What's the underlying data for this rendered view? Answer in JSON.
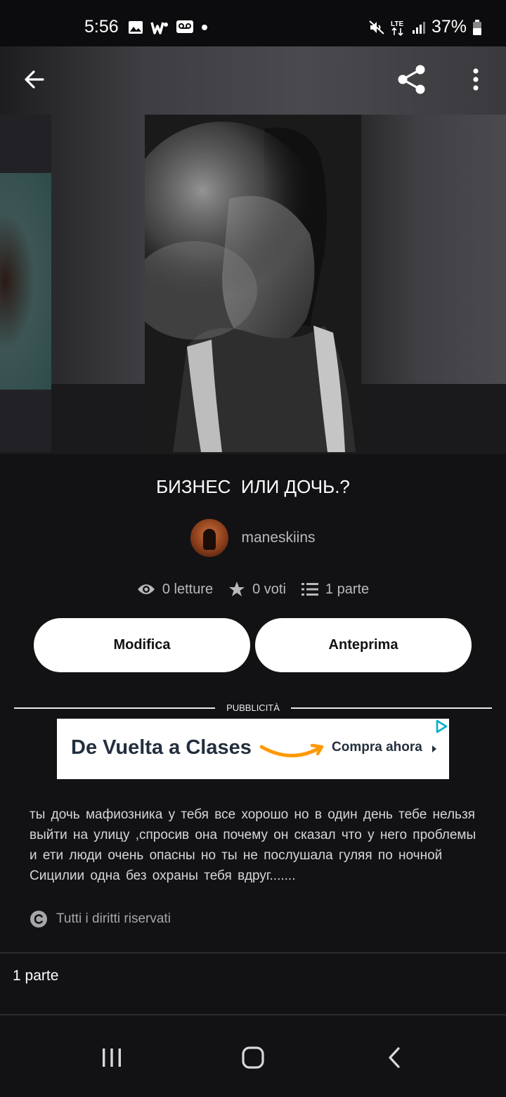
{
  "status_bar": {
    "time": "5:56",
    "battery": "37%",
    "network": "LTE"
  },
  "toolbar": {
    "back_icon": "arrow-left-icon",
    "share_icon": "share-icon",
    "more_icon": "more-vertical-icon"
  },
  "story": {
    "title": "БИЗНЕС  ИЛИ ДОЧЬ.?",
    "author": "maneskiins",
    "stats": {
      "reads": "0 letture",
      "votes": "0 voti",
      "parts": "1 parte"
    },
    "description": "ты дочь  мафиозника у тебя  все  хорошо  но в один день  тебе нельзя  выйти на улицу  ,спросив она почему  он  сказал  что  у него проблемы  и ети  люди  очень  опасны  но ты не послушала  гуляя по ночной  Сицилии  одна без  охраны  тебя  вдруг.......",
    "copyright": "Tutti i diritti riservati"
  },
  "buttons": {
    "edit": "Modifica",
    "preview": "Anteprima"
  },
  "ad": {
    "label": "PUBBLICITÀ",
    "headline": "De Vuelta a Clases",
    "cta": "Compra ahora",
    "accent_color": "#ff9900",
    "text_color": "#232f3e"
  },
  "parts_section": {
    "label": "1 parte"
  },
  "nav_bar": {
    "recents_icon": "recents-icon",
    "home_icon": "home-icon",
    "back_icon": "nav-back-icon"
  },
  "colors": {
    "background": "#121214",
    "button_bg": "#ffffff",
    "muted_text": "#b9b9bd"
  }
}
